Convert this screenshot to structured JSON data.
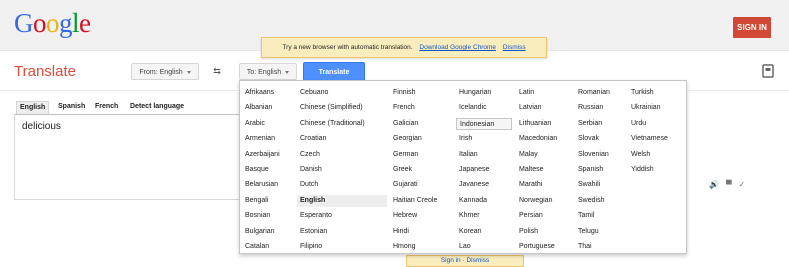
{
  "header": {
    "logo_letters": [
      {
        "ch": "G",
        "color": "#3369e8"
      },
      {
        "ch": "o",
        "color": "#d50f25"
      },
      {
        "ch": "o",
        "color": "#eeb211"
      },
      {
        "ch": "g",
        "color": "#3369e8"
      },
      {
        "ch": "l",
        "color": "#009925"
      },
      {
        "ch": "e",
        "color": "#d50f25"
      }
    ],
    "sign_in_label": "SIGN IN"
  },
  "notice": {
    "text": "Try a new browser with automatic translation.",
    "download_link": "Download Google Chrome",
    "dismiss_link": "Dismiss",
    "lower_partial": "Sign in  ·  Dismiss"
  },
  "toolbar": {
    "title": "Translate",
    "from_label": "From: English",
    "to_label": "To: English",
    "translate_label": "Translate",
    "swap_icon": "⇆"
  },
  "source_tabs": [
    "English",
    "Spanish",
    "French",
    "Detect language"
  ],
  "source_text": "delicious",
  "result_icons": [
    "speaker-icon",
    "comment-icon",
    "check-icon"
  ],
  "language_columns": [
    [
      "Afrikaans",
      "Albanian",
      "Arabic",
      "Armenian",
      "Azerbaijani",
      "Basque",
      "Belarusian",
      "Bengali",
      "Bosnian",
      "Bulgarian",
      "Catalan"
    ],
    [
      "Cebuano",
      "Chinese (Simplified)",
      "Chinese (Traditional)",
      "Croatian",
      "Czech",
      "Danish",
      "Dutch",
      "English",
      "Esperanto",
      "Estonian",
      "Filipino"
    ],
    [
      "Finnish",
      "French",
      "Galician",
      "Georgian",
      "German",
      "Greek",
      "Gujarati",
      "Haitian Creole",
      "Hebrew",
      "Hindi",
      "Hmong"
    ],
    [
      "Hungarian",
      "Icelandic",
      "Indonesian",
      "Irish",
      "Italian",
      "Japanese",
      "Javanese",
      "Kannada",
      "Khmer",
      "Korean",
      "Lao"
    ],
    [
      "Latin",
      "Latvian",
      "Lithuanian",
      "Macedonian",
      "Malay",
      "Maltese",
      "Marathi",
      "Norwegian",
      "Persian",
      "Polish",
      "Portuguese"
    ],
    [
      "Romanian",
      "Russian",
      "Serbian",
      "Slovak",
      "Slovenian",
      "Spanish",
      "Swahili",
      "Swedish",
      "Tamil",
      "Telugu",
      "Thai"
    ],
    [
      "Turkish",
      "Ukrainian",
      "Urdu",
      "Vietnamese",
      "Welsh",
      "Yiddish"
    ]
  ],
  "selected_language": "English",
  "hovered_language": "Indonesian",
  "colors": {
    "accent_red": "#dd4b39",
    "signin_red": "#d14836",
    "translate_blue": "#4d90fe",
    "link_blue": "#15c"
  }
}
